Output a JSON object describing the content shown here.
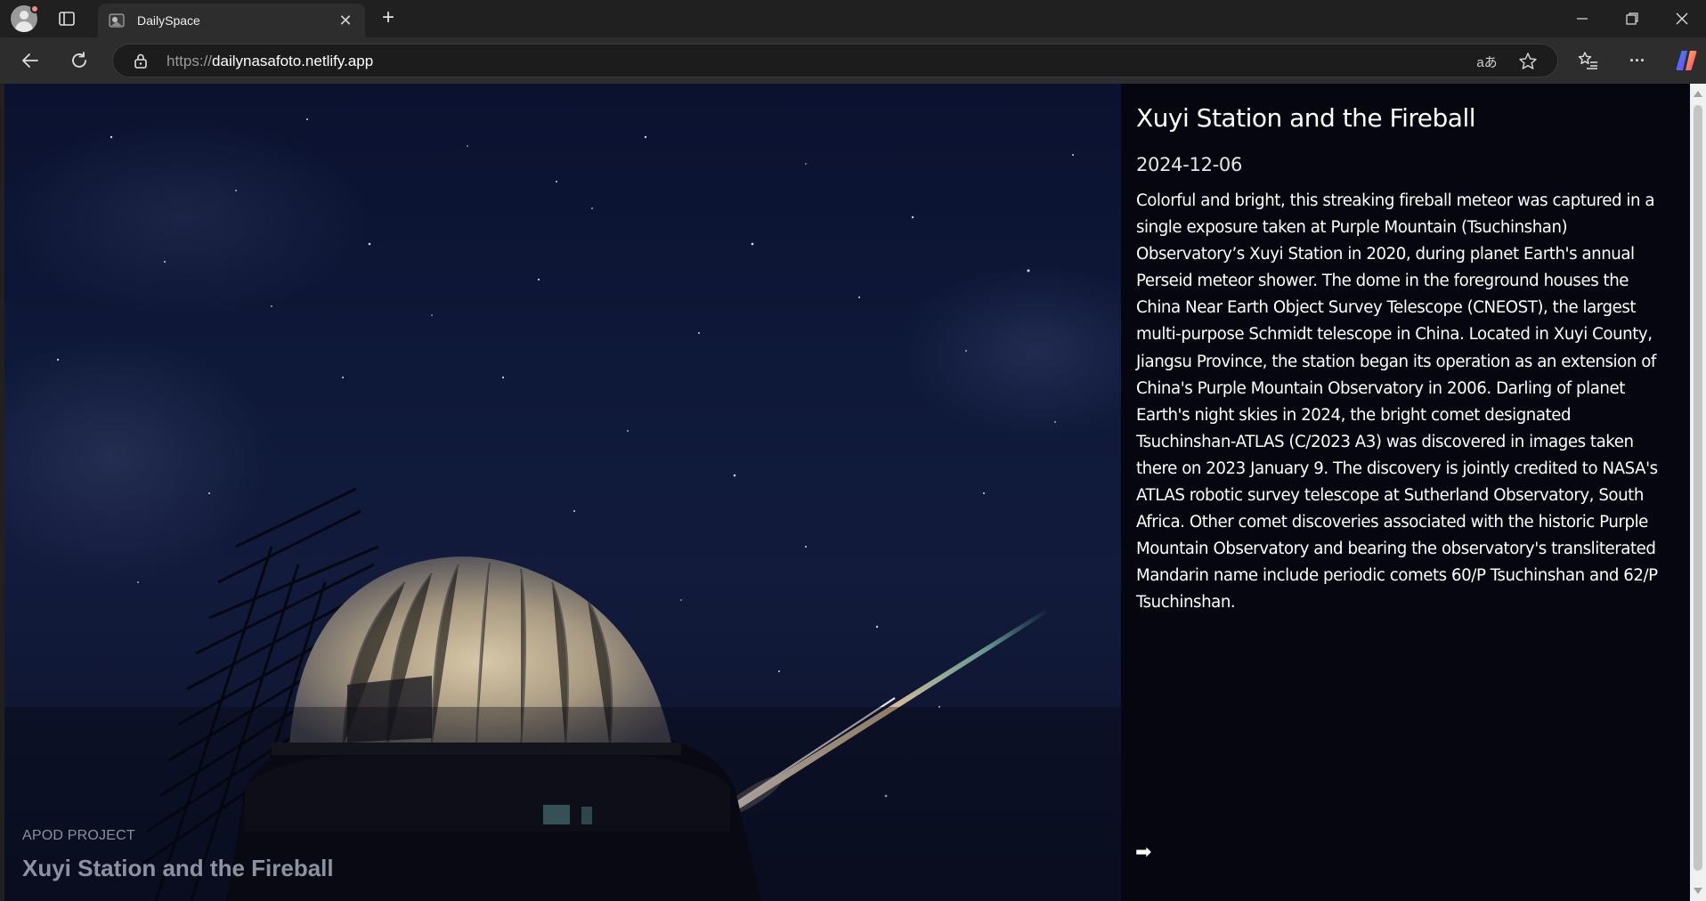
{
  "browser": {
    "tab": {
      "title": "DailySpace",
      "close_glyph": "✕",
      "favicon": "site-favicon"
    },
    "new_tab_glyph": "+",
    "window_controls": [
      "minimize-icon",
      "maximize-icon",
      "close-icon"
    ],
    "address": {
      "scheme": "https://",
      "host": "dailynasafoto.netlify.app"
    },
    "toolbar_icons": [
      "back-icon",
      "reload-icon",
      "lock-icon",
      "read-aloud-icon",
      "favorite-star-icon",
      "favorites-list-icon",
      "more-icon",
      "copilot-icon"
    ],
    "read_aloud_glyph": "aあ",
    "more_glyph": "···"
  },
  "page": {
    "hero": {
      "label": "APOD PROJECT",
      "title": "Xuyi Station and the Fireball"
    },
    "panel": {
      "title": "Xuyi Station and the Fireball",
      "date": "2024-12-06",
      "explanation": "Colorful and bright, this streaking fireball meteor was captured in a single exposure taken at Purple Mountain (Tsuchinshan) Observatory’s Xuyi Station in 2020, during planet Earth's annual Perseid meteor shower. The dome in the foreground houses the China Near Earth Object Survey Telescope (CNEOST), the largest multi-purpose Schmidt telescope in China. Located in Xuyi County, Jiangsu Province, the station began its operation as an extension of China's Purple Mountain Observatory in 2006. Darling of planet Earth's night skies in 2024, the bright comet designated Tsuchinshan-ATLAS (C/2023 A3) was discovered in images taken there on 2023 January 9. The discovery is jointly credited to NASA's ATLAS robotic survey telescope at Sutherland Observatory, South Africa. Other comet discoveries associated with the historic Purple Mountain Observatory and bearing the observatory's transliterated Mandarin name include periodic comets 60/P Tsuchinshan and 62/P Tsuchinshan.",
      "next_glyph": "➡"
    }
  },
  "colors": {
    "chrome_bg": "#202020",
    "toolbar_bg": "#2d2d2d",
    "page_bg": "#05060f",
    "sky": "#0e1838"
  }
}
